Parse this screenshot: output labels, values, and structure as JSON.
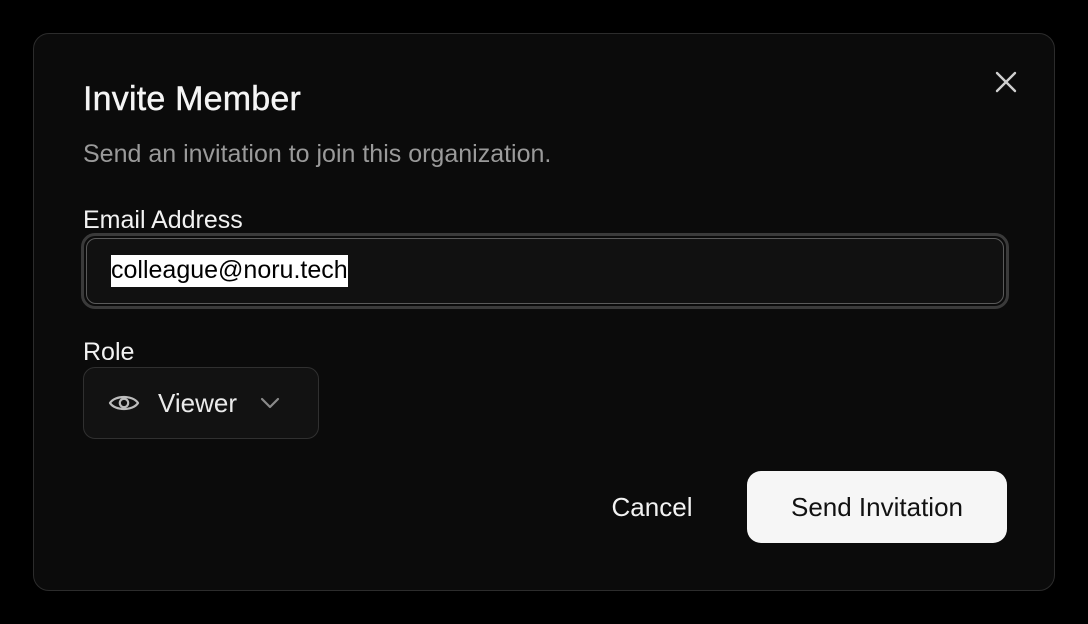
{
  "dialog": {
    "title": "Invite Member",
    "subtitle": "Send an invitation to join this organization.",
    "close_icon": "close-icon"
  },
  "email": {
    "label": "Email Address",
    "value": "colleague@noru.tech",
    "selected": true
  },
  "role": {
    "label": "Role",
    "selected": "Viewer",
    "icon": "eye-icon",
    "dropdown_icon": "chevron-down-icon"
  },
  "actions": {
    "cancel_label": "Cancel",
    "send_label": "Send Invitation"
  },
  "colors": {
    "page_background": "#000000",
    "dialog_background": "#0b0b0b",
    "primary_button": "#f6f6f6",
    "muted_text": "#9a9a9a"
  }
}
